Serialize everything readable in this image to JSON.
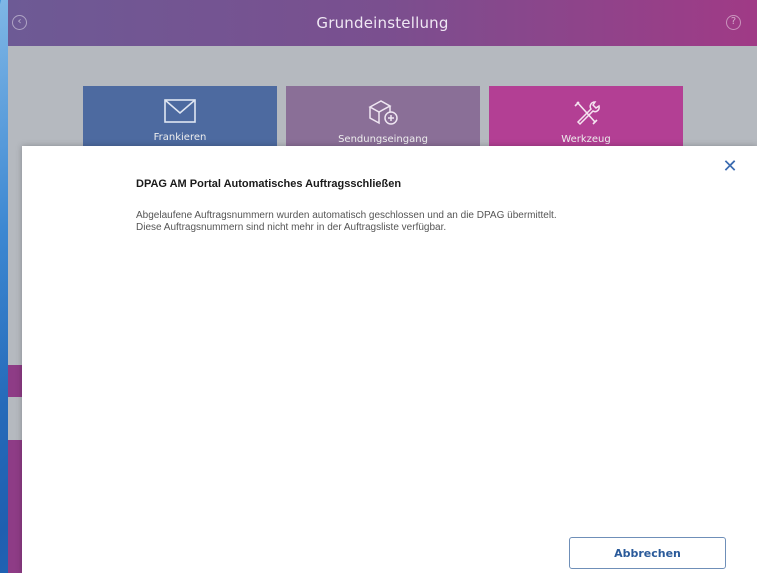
{
  "window": {
    "title": "Grundeinstellung"
  },
  "tiles": [
    {
      "label": "Frankieren",
      "icon": "envelope-icon",
      "color": "#4d6aa0"
    },
    {
      "label": "Sendungseingang",
      "icon": "package-add-icon",
      "color": "#8a6f97"
    },
    {
      "label": "Werkzeug",
      "icon": "tools-icon",
      "color": "#b33f94"
    }
  ],
  "dialog": {
    "heading": "DPAG AM Portal Automatisches Auftragsschließen",
    "line1": "Abgelaufene Auftragsnummern wurden automatisch geschlossen und an die DPAG übermittelt.",
    "line2": "Diese Auftragsnummern sind nicht mehr in der Auftragsliste verfügbar.",
    "close_icon": "close-icon",
    "cancel_label": "Abbrechen"
  },
  "colors": {
    "titlebar_start": "#6d5a95",
    "titlebar_end": "#a03a86",
    "accent_blue": "#2a5a9a"
  }
}
